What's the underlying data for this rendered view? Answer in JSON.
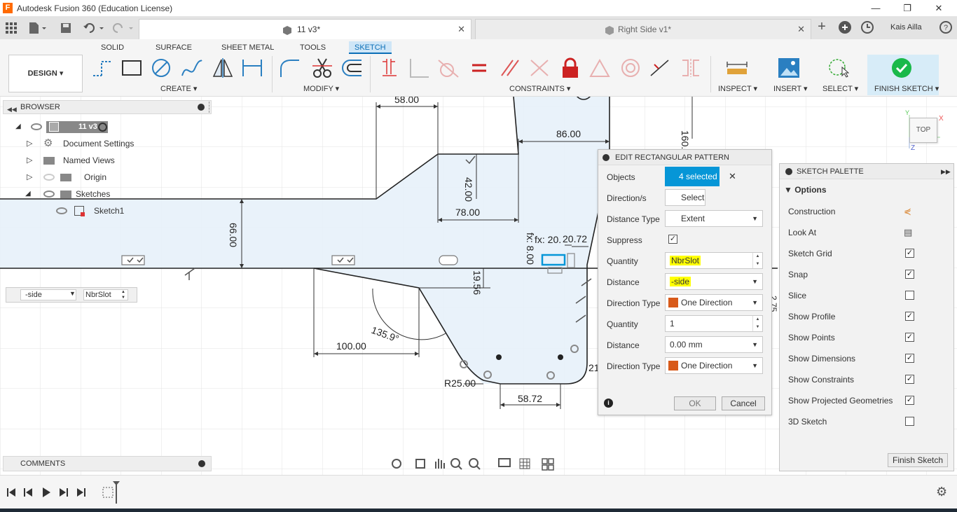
{
  "window": {
    "title": "Autodesk Fusion 360 (Education License)",
    "logo": "F",
    "min_glyph": "—",
    "max_glyph": "❐",
    "close_glyph": "✕"
  },
  "tabs": {
    "active_label": "11 v3*",
    "inactive_label": "Right Side v1*",
    "plus": "+",
    "user": "Kais Ailla",
    "close_glyph": "✕"
  },
  "workspace_tabs": [
    "SOLID",
    "SURFACE",
    "SHEET METAL",
    "TOOLS",
    "SKETCH"
  ],
  "toolbar": {
    "design": "DESIGN ▾",
    "create": "CREATE ▾",
    "modify": "MODIFY ▾",
    "constraints": "CONSTRAINTS ▾",
    "inspect": "INSPECT ▾",
    "insert": "INSERT ▾",
    "select": "SELECT ▾",
    "finish": "FINISH SKETCH ▾"
  },
  "browser": {
    "title": "BROWSER",
    "root": "11 v3",
    "items": [
      "Document Settings",
      "Named Views",
      "Origin",
      "Sketches",
      "Sketch1"
    ]
  },
  "comments": {
    "title": "COMMENTS"
  },
  "viewcube": {
    "label": "TOP",
    "x": "X",
    "y": "Y",
    "z": "Z"
  },
  "canvas_inputs": {
    "dist_value": "-side",
    "qty_value": "NbrSlot"
  },
  "dimensions": {
    "d1": "58.00",
    "d2": "86.00",
    "d3": "160.",
    "d4": "42.00",
    "d5": "78.00",
    "d6": "66.00",
    "d7": "19.56",
    "d8": "135.9°",
    "d9": "100.00",
    "d10": "R25.00",
    "d11": "58.72",
    "d12": "fx: 20.",
    "d13": "20.72",
    "d14": "fx: 8.00",
    "d15": "2.75",
    "d16": "21"
  },
  "dialog": {
    "title": "EDIT RECTANGULAR PATTERN",
    "objects_label": "Objects",
    "objects_value": "4 selected",
    "direction_label": "Direction/s",
    "direction_value": "Select",
    "dist_type_label": "Distance Type",
    "dist_type_value": "Extent",
    "suppress_label": "Suppress",
    "qty1_label": "Quantity",
    "qty1_value": "NbrSlot",
    "dist1_label": "Distance",
    "dist1_value": "-side",
    "dir_type1_label": "Direction Type",
    "dir_type1_value": "One Direction",
    "qty2_label": "Quantity",
    "qty2_value": "1",
    "dist2_label": "Distance",
    "dist2_value": "0.00 mm",
    "dir_type2_label": "Direction Type",
    "dir_type2_value": "One Direction",
    "ok": "OK",
    "cancel": "Cancel",
    "info": "i",
    "clear": "✕"
  },
  "palette": {
    "title": "SKETCH PALETTE",
    "section": "Options",
    "rows": [
      {
        "label": "Construction",
        "checked": null
      },
      {
        "label": "Look At",
        "checked": null
      },
      {
        "label": "Sketch Grid",
        "checked": true
      },
      {
        "label": "Snap",
        "checked": true
      },
      {
        "label": "Slice",
        "checked": false
      },
      {
        "label": "Show Profile",
        "checked": true
      },
      {
        "label": "Show Points",
        "checked": true
      },
      {
        "label": "Show Dimensions",
        "checked": true
      },
      {
        "label": "Show Constraints",
        "checked": true
      },
      {
        "label": "Show Projected Geometries",
        "checked": true
      },
      {
        "label": "3D Sketch",
        "checked": false
      }
    ],
    "finish": "Finish Sketch"
  },
  "colors": {
    "accent": "#0696d7",
    "highlight": "#ffff00",
    "sketch_fill": "#e6f1fa",
    "finish_green": "#1ab94a"
  }
}
